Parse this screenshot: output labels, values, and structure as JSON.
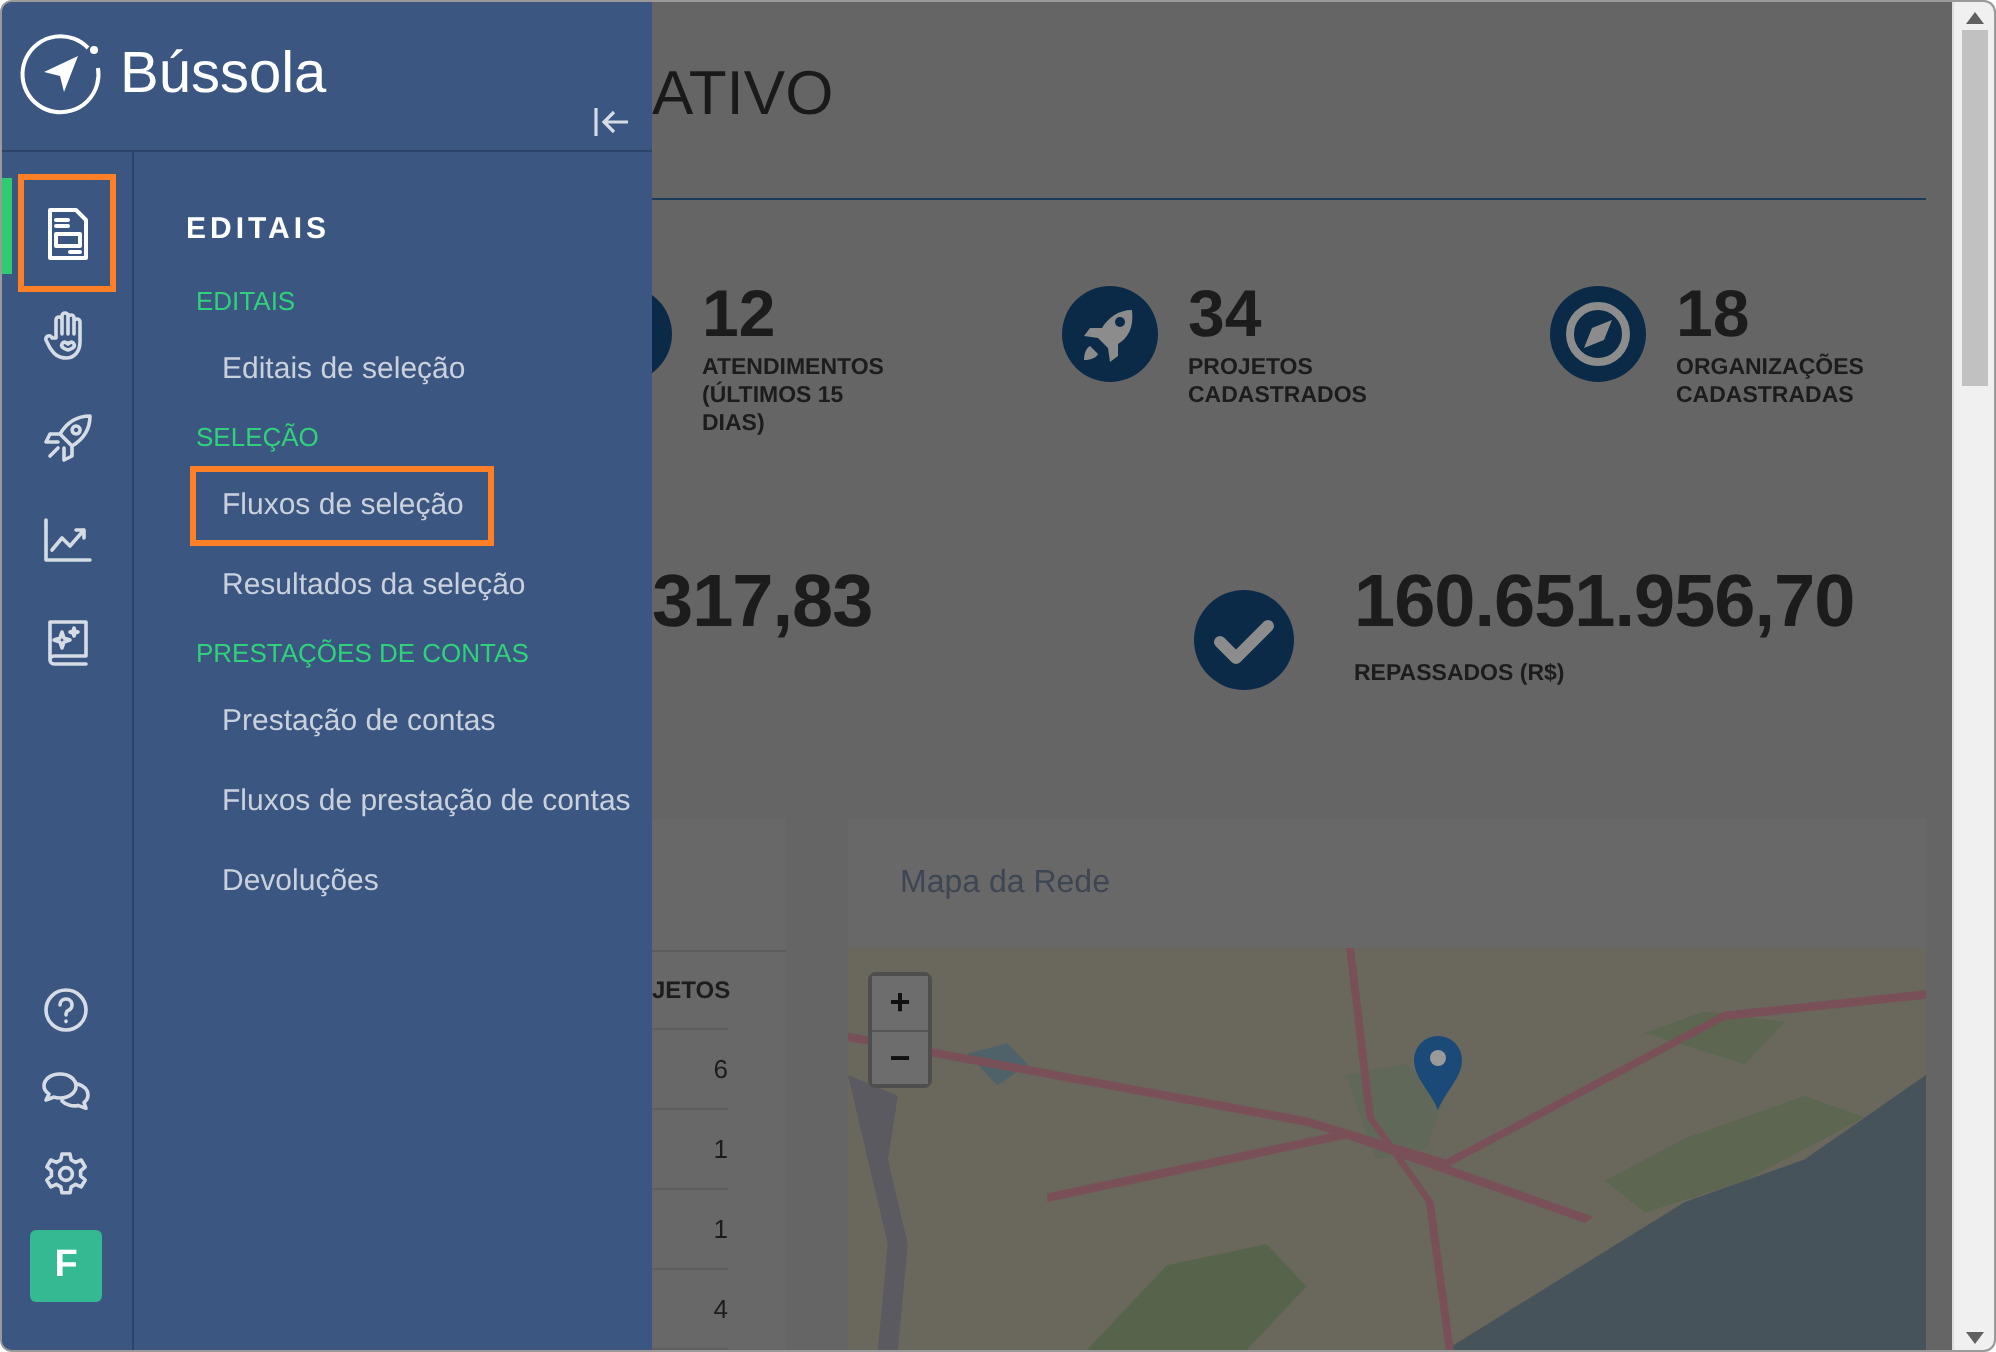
{
  "sidebar": {
    "brand": "Bússola",
    "rail": [
      {
        "kind": "document",
        "selected": true,
        "highlighted": true
      },
      {
        "kind": "hand",
        "selected": false,
        "highlighted": false
      },
      {
        "kind": "rocket",
        "selected": false,
        "highlighted": false
      },
      {
        "kind": "chart",
        "selected": false,
        "highlighted": false
      },
      {
        "kind": "book",
        "selected": false,
        "highlighted": false
      }
    ],
    "rail_bottom": [
      {
        "kind": "help"
      },
      {
        "kind": "chat"
      },
      {
        "kind": "settings"
      }
    ],
    "avatar": "F",
    "menu": {
      "title": "EDITAIS",
      "sections": [
        {
          "heading": "EDITAIS",
          "items": [
            {
              "label": "Editais de seleção",
              "highlighted": false
            }
          ]
        },
        {
          "heading": "SELEÇÃO",
          "items": [
            {
              "label": "Fluxos de seleção",
              "highlighted": true
            },
            {
              "label": "Resultados da seleção",
              "highlighted": false
            }
          ]
        },
        {
          "heading": "PRESTAÇÕES DE CONTAS",
          "items": [
            {
              "label": "Prestação de contas",
              "highlighted": false
            },
            {
              "label": "Fluxos de prestação de contas",
              "highlighted": false
            },
            {
              "label": "Devoluções",
              "highlighted": false
            }
          ]
        }
      ]
    }
  },
  "main": {
    "page_title": "ATIVO",
    "stats": [
      {
        "kind": "cut",
        "value": "12",
        "label": "ATENDIMENTOS (ÚLTIMOS 15 DIAS)"
      },
      {
        "kind": "rocket",
        "value": "34",
        "label": "PROJETOS CADASTRADOS"
      },
      {
        "kind": "compass",
        "value": "18",
        "label": "ORGANIZAÇÕES CADASTRADAS"
      }
    ],
    "totals": [
      {
        "kind": "none",
        "value": "317,83"
      },
      {
        "kind": "check",
        "value": "160.651.956,70",
        "label": "REPASSADOS (R$)"
      }
    ],
    "table": {
      "column": "JETOS",
      "rows": [
        "6",
        "1",
        "1",
        "4"
      ]
    },
    "map": {
      "title": "Mapa da Rede",
      "zoom_in": "+",
      "zoom_out": "−"
    }
  }
}
